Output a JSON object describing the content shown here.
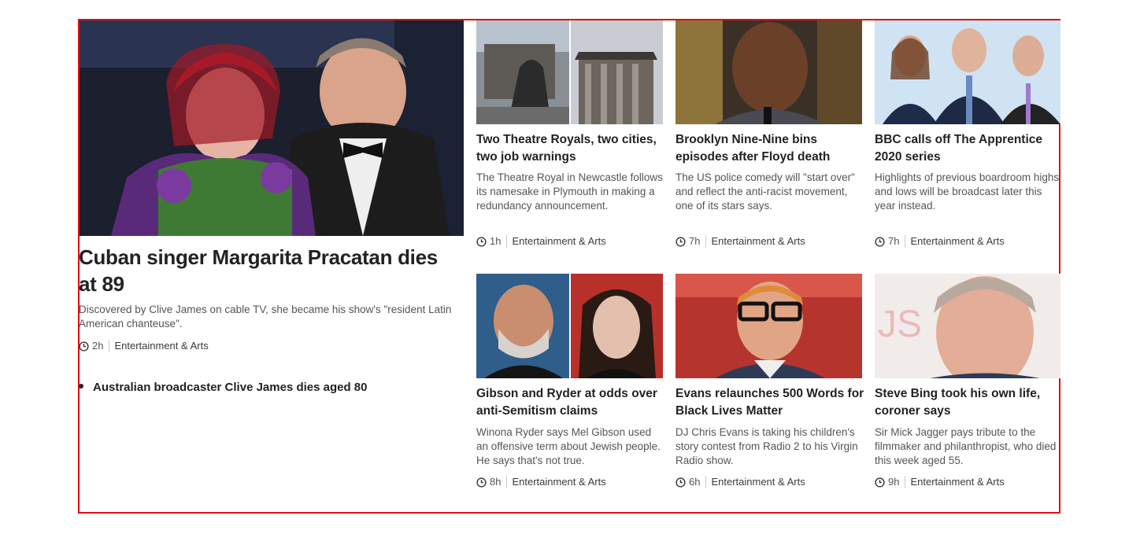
{
  "lead": {
    "headline": "Cuban singer Margarita Pracatan dies at 89",
    "summary": "Discovered by Clive James on cable TV, she became his show's \"resident Latin American chanteuse\".",
    "time": "2h",
    "section": "Entertainment & Arts",
    "related": "Australian broadcaster Clive James dies aged 80"
  },
  "stories": [
    {
      "headline": "Two Theatre Royals, two cities, two job warnings",
      "summary": "The Theatre Royal in Newcastle follows its namesake in Plymouth in making a redundancy announcement.",
      "time": "1h",
      "section": "Entertainment & Arts"
    },
    {
      "headline": "Brooklyn Nine-Nine bins episodes after Floyd death",
      "summary": "The US police comedy will \"start over\" and reflect the anti-racist movement, one of its stars says.",
      "time": "7h",
      "section": "Entertainment & Arts"
    },
    {
      "headline": "BBC calls off The Apprentice 2020 series",
      "summary": "Highlights of previous boardroom highs and lows will be broadcast later this year instead.",
      "time": "7h",
      "section": "Entertainment & Arts"
    },
    {
      "headline": "Gibson and Ryder at odds over anti-Semitism claims",
      "summary": "Winona Ryder says Mel Gibson used an offensive term about Jewish people. He says that's not true.",
      "time": "8h",
      "section": "Entertainment & Arts"
    },
    {
      "headline": "Evans relaunches 500 Words for Black Lives Matter",
      "summary": "DJ Chris Evans is taking his children's story contest from Radio 2 to his Virgin Radio show.",
      "time": "6h",
      "section": "Entertainment & Arts"
    },
    {
      "headline": "Steve Bing took his own life, coroner says",
      "summary": "Sir Mick Jagger pays tribute to the filmmaker and philanthropist, who died this week aged 55.",
      "time": "9h",
      "section": "Entertainment & Arts"
    }
  ],
  "colors": {
    "frame": "#e10d16",
    "text": "#222222",
    "muted": "#555555"
  }
}
